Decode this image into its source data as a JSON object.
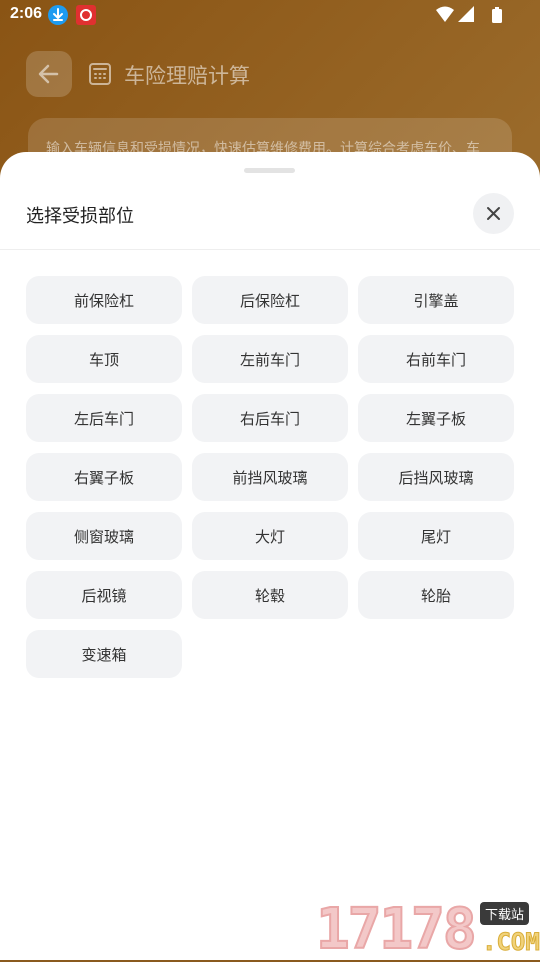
{
  "status_bar": {
    "time": "2:06"
  },
  "background": {
    "title": "车险理赔计算",
    "intro": "输入车辆信息和受损情况，快速估算维修费用。计算综合考虑车价、车"
  },
  "sheet": {
    "title": "选择受损部位",
    "parts": [
      "前保险杠",
      "后保险杠",
      "引擎盖",
      "车顶",
      "左前车门",
      "右前车门",
      "左后车门",
      "右后车门",
      "左翼子板",
      "右翼子板",
      "前挡风玻璃",
      "后挡风玻璃",
      "侧窗玻璃",
      "大灯",
      "尾灯",
      "后视镜",
      "轮毂",
      "轮胎",
      "变速箱"
    ]
  },
  "watermark": {
    "digits": "17178",
    "tag": "下载站",
    "com": ".COM"
  },
  "icons": {
    "back": "arrow-left-icon",
    "calculator": "calculator-icon",
    "close": "close-icon",
    "download": "download-icon",
    "wifi": "wifi-icon",
    "signal": "signal-icon",
    "battery": "battery-icon"
  },
  "colors": {
    "sheet_bg": "#ffffff",
    "chip_bg": "#f2f3f5",
    "chip_text": "#333333",
    "backdrop": "#8a5a1e"
  }
}
